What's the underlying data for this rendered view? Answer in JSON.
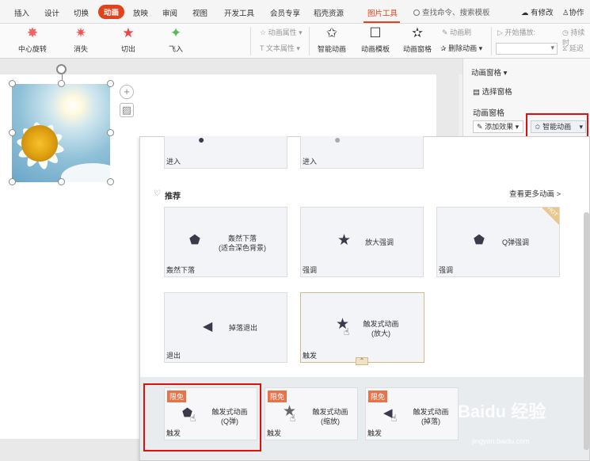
{
  "menu": {
    "items": [
      "插入",
      "设计",
      "切换",
      "动画",
      "放映",
      "审阅",
      "视图",
      "开发工具",
      "会员专享",
      "稻壳资源",
      "图片工具"
    ],
    "active": "动画",
    "search": "查找命令、搜索模板",
    "right": [
      "有修改",
      "协作"
    ]
  },
  "ribbon": {
    "effects": [
      "中心旋转",
      "消失",
      "切出",
      "飞入"
    ],
    "effect_options": [
      "动画属性",
      "文本属性"
    ],
    "tools": [
      "智能动画",
      "动画模板",
      "动画窗格",
      "动画刷",
      "删除动画"
    ],
    "start_label": "开始播放:",
    "duration_label": "持续时",
    "delay_label": "延迟"
  },
  "panel": {
    "title": "动画窗格",
    "select_pane": "选择窗格",
    "heading": "动画窗格",
    "add_effect": "添加效果",
    "smart": "智能动画"
  },
  "gallery": {
    "top_tags": [
      "进入",
      "进入"
    ],
    "section_title": "推荐",
    "more_link": "查看更多动画 >",
    "hot": "HOT",
    "cards": [
      {
        "name": "轰然下落",
        "sub": "(适合深色背景)",
        "tag": "轰然下落"
      },
      {
        "name": "放大强调",
        "sub": "",
        "tag": "强调"
      },
      {
        "name": "Q弹强调",
        "sub": "",
        "tag": "强调"
      },
      {
        "name": "掉落退出",
        "sub": "",
        "tag": "退出"
      },
      {
        "name": "触发式动画",
        "sub": "(放大)",
        "tag": "触发"
      }
    ],
    "free_cards": [
      {
        "badge": "限免",
        "name": "触发式动画",
        "sub": "(Q弹)",
        "tag": "触发"
      },
      {
        "badge": "限免",
        "name": "触发式动画",
        "sub": "(缩放)",
        "tag": "触发"
      },
      {
        "badge": "限免",
        "name": "触发式动画",
        "sub": "(掉落)",
        "tag": "触发"
      }
    ]
  },
  "watermark": {
    "brand": "Baidu 经验",
    "url": "jingyan.baidu.com"
  },
  "colors": {
    "accent": "#e0421b",
    "highlight": "#e01010",
    "badge": "#e8734a"
  }
}
